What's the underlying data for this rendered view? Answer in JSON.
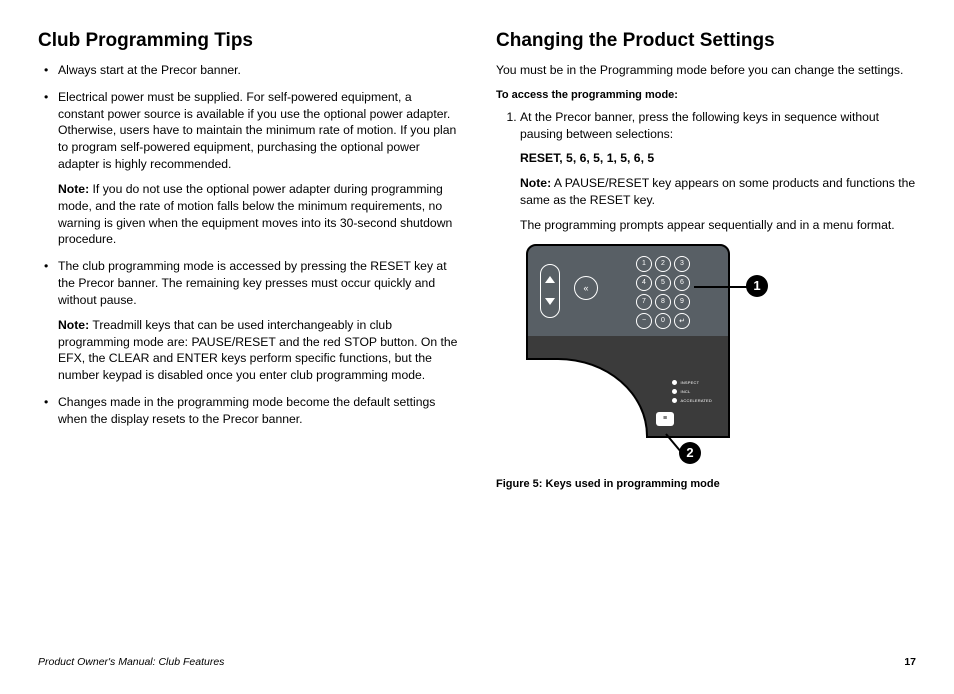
{
  "left": {
    "heading": "Club Programming Tips",
    "bullets": [
      {
        "text": "Always start at the Precor banner."
      },
      {
        "text": "Electrical power must be supplied. For self-powered equipment, a constant power source is available if you use the optional power adapter. Otherwise, users have to maintain the minimum rate of motion. If you plan to program self-powered equipment, purchasing the optional power adapter is highly recommended.",
        "note_label": "Note:",
        "note": " If you do not use the optional power adapter during programming mode, and the rate of motion falls below the minimum requirements, no warning is given when the equipment moves into its 30-second shutdown procedure."
      },
      {
        "text": "The club programming mode is accessed by pressing the RESET key at the Precor banner. The remaining key presses must occur quickly and without pause.",
        "note_label": "Note:",
        "note": " Treadmill keys that can be used interchangeably in club programming mode are: PAUSE/RESET and the red STOP button. On the EFX, the CLEAR and ENTER keys perform specific functions, but the number keypad is disabled once you enter club programming mode."
      },
      {
        "text": "Changes made in the programming mode become the default settings when the display resets to the Precor banner."
      }
    ]
  },
  "right": {
    "heading": "Changing the Product Settings",
    "intro": "You must be in the Programming mode before you can change the settings.",
    "sub_heading": "To access the programming mode:",
    "step_text": "At the Precor banner, press the following keys in sequence without pausing between selections:",
    "key_sequence": "RESET, 5, 6, 5, 1, 5, 6, 5",
    "step_note_label": "Note:",
    "step_note": " A PAUSE/RESET key appears on some products and functions the same as the RESET key.",
    "step_note2": "The programming prompts appear sequentially and in a menu format.",
    "figure_caption": "Figure 5: Keys used in programming mode",
    "callout1": "1",
    "callout2": "2"
  },
  "footer": {
    "left": "Product Owner's Manual: Club Features",
    "right": "17"
  }
}
